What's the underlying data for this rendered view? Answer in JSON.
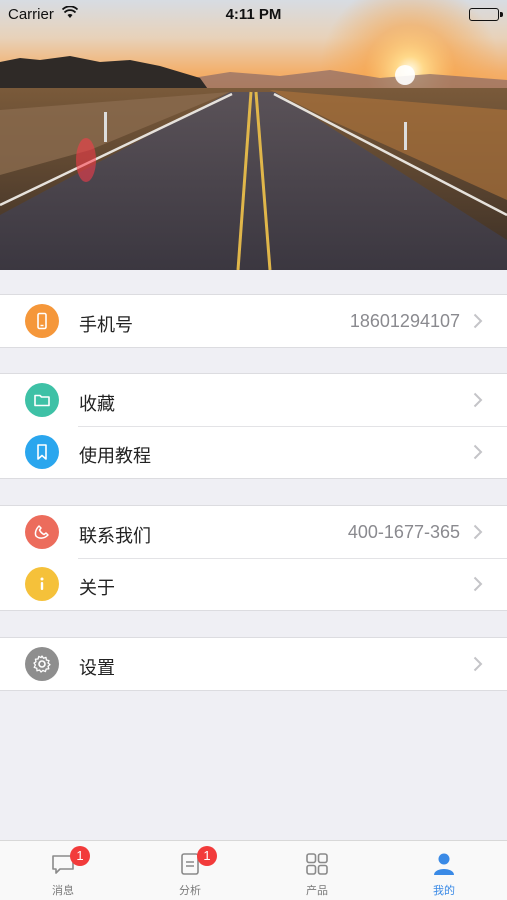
{
  "status_bar": {
    "carrier": "Carrier",
    "time": "4:11 PM"
  },
  "hero": {
    "image": "road-sunset-image"
  },
  "groups": [
    {
      "rows": [
        {
          "label": "手机号",
          "value": "18601294107",
          "icon": "phone-device-icon",
          "color": "#f5973a"
        }
      ]
    },
    {
      "rows": [
        {
          "label": "收藏",
          "value": "",
          "icon": "folder-icon",
          "color": "#3ec1a6"
        },
        {
          "label": "使用教程",
          "value": "",
          "icon": "bookmark-icon",
          "color": "#2aa6ee"
        }
      ]
    },
    {
      "rows": [
        {
          "label": "联系我们",
          "value": "400-1677-365",
          "icon": "phone-handset-icon",
          "color": "#ec6c5c"
        },
        {
          "label": "关于",
          "value": "",
          "icon": "info-icon",
          "color": "#f5c13a"
        }
      ]
    },
    {
      "rows": [
        {
          "label": "设置",
          "value": "",
          "icon": "gear-icon",
          "color": "#8e8e8e"
        }
      ]
    }
  ],
  "tabbar": {
    "tabs": [
      {
        "label": "消息",
        "icon": "message-icon",
        "badge": "1",
        "active": false
      },
      {
        "label": "分析",
        "icon": "document-icon",
        "badge": "1",
        "active": false
      },
      {
        "label": "产品",
        "icon": "grid-icon",
        "badge": "",
        "active": false
      },
      {
        "label": "我的",
        "icon": "person-icon",
        "badge": "",
        "active": true
      }
    ],
    "active_color": "#3a8ae6"
  }
}
